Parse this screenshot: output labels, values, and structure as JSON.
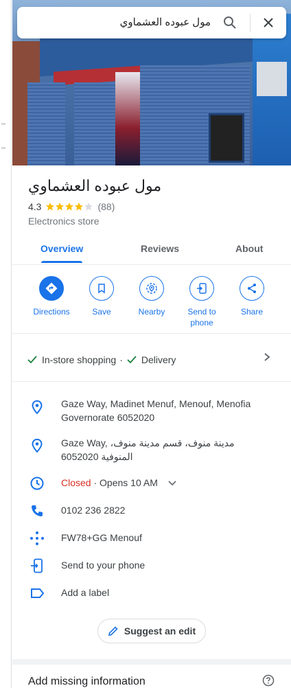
{
  "search": {
    "query": "مول عبوده العشماوي"
  },
  "place": {
    "name": "مول عبوده العشماوي",
    "rating": "4.3",
    "reviews_count": "(88)",
    "category": "Electronics store"
  },
  "tabs": [
    {
      "label": "Overview"
    },
    {
      "label": "Reviews"
    },
    {
      "label": "About"
    }
  ],
  "actions": [
    {
      "label": "Directions",
      "icon": "directions-icon"
    },
    {
      "label": "Save",
      "icon": "bookmark-icon"
    },
    {
      "label": "Nearby",
      "icon": "nearby-icon"
    },
    {
      "label": "Send to phone",
      "icon": "send-to-phone-icon"
    },
    {
      "label": "Share",
      "icon": "share-icon"
    }
  ],
  "amenities": {
    "item1": "In-store shopping",
    "separator": "·",
    "item2": "Delivery"
  },
  "info": {
    "address_en": "Gaze Way, Madinet Menuf, Menouf, Menofia Governorate 6052020",
    "address_ar": "Gaze Way, مدينة منوف، قسم مدينة منوف، المنوفية 6052020",
    "hours_status": "Closed",
    "hours_next": " · Opens 10 AM",
    "phone": "0102 236 2822",
    "plus_code": "FW78+GG Menouf",
    "send_to_phone": "Send to your phone",
    "add_label": "Add a label"
  },
  "suggest_edit": "Suggest an edit",
  "missing_info": "Add missing information",
  "colors": {
    "accent": "#1a73e8",
    "star": "#fbbc04",
    "closed": "#d93025"
  }
}
